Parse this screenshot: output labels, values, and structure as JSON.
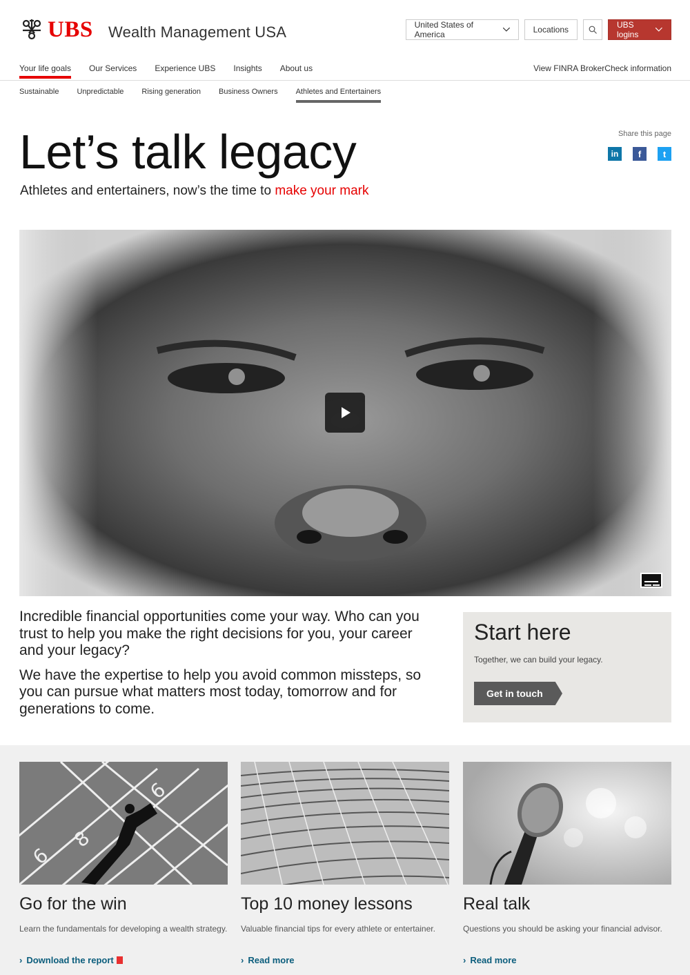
{
  "brand": {
    "logo_text": "UBS",
    "subtitle": "Wealth Management USA"
  },
  "top_controls": {
    "country": "United States of America",
    "locations": "Locations",
    "logins": "UBS logins"
  },
  "main_nav": [
    {
      "label": "Your life goals",
      "active": true
    },
    {
      "label": "Our Services"
    },
    {
      "label": "Experience UBS"
    },
    {
      "label": "Insights"
    },
    {
      "label": "About us"
    }
  ],
  "finra_link": "View FINRA BrokerCheck information",
  "sub_nav": [
    {
      "label": "Sustainable"
    },
    {
      "label": "Unpredictable"
    },
    {
      "label": "Rising generation"
    },
    {
      "label": "Business Owners"
    },
    {
      "label": "Athletes and Entertainers",
      "active": true
    }
  ],
  "hero": {
    "title": "Let’s talk legacy",
    "subtitle_prefix": "Athletes and entertainers, now’s the time to ",
    "subtitle_highlight": "make your mark"
  },
  "share": {
    "label": "Share this page",
    "icons": [
      "linkedin-icon",
      "facebook-icon",
      "twitter-icon"
    ]
  },
  "intro": {
    "p1": "Incredible financial opportunities come your way. Who can you trust to help you make the right decisions for you, your career and your legacy?",
    "p2": "We have the expertise to help you avoid common missteps, so you can pursue what matters most today, tomorrow and for generations to come."
  },
  "start_here": {
    "title": "Start here",
    "text": "Together, we can build your legacy.",
    "button": "Get in touch"
  },
  "cards": [
    {
      "title": "Go for the win",
      "desc": "Learn the fundamentals for developing a wealth strategy.",
      "link": "Download the report"
    },
    {
      "title": "Top 10 money lessons",
      "desc": "Valuable financial tips for every athlete or entertainer.",
      "link": "Read more"
    },
    {
      "title": "Real talk",
      "desc": "Questions you should be asking your financial advisor.",
      "link": "Read more"
    }
  ],
  "colors": {
    "brand_red": "#e60000",
    "logins_bg": "#b7372f",
    "link_blue": "#0b5d7c",
    "card_bg": "#f0f0f0",
    "start_bg": "#e8e7e4"
  }
}
